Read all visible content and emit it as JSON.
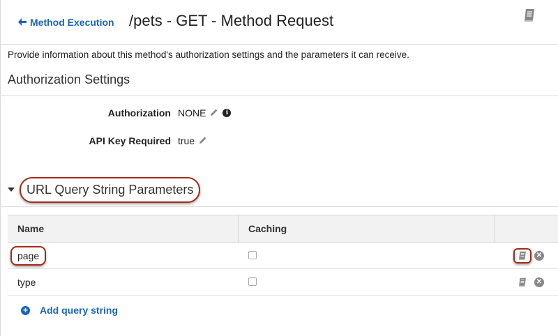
{
  "header": {
    "back_label": "Method Execution",
    "title": "/pets - GET - Method Request",
    "book_icon": "book-icon"
  },
  "description": "Provide information about this method's authorization settings and the parameters it can receive.",
  "authorization_section": {
    "title": "Authorization Settings",
    "authorization_label": "Authorization",
    "authorization_value": "NONE",
    "api_key_label": "API Key Required",
    "api_key_value": "true"
  },
  "query_params": {
    "title": "URL Query String Parameters",
    "columns": [
      "Name",
      "Caching"
    ],
    "rows": [
      {
        "name": "page",
        "caching": false,
        "highlighted": true
      },
      {
        "name": "type",
        "caching": false,
        "highlighted": false
      }
    ],
    "add_label": "Add query string"
  },
  "colors": {
    "link": "#1a66b8",
    "highlight_border": "#a52a1a",
    "table_header_bg": "#f2f2f2"
  }
}
